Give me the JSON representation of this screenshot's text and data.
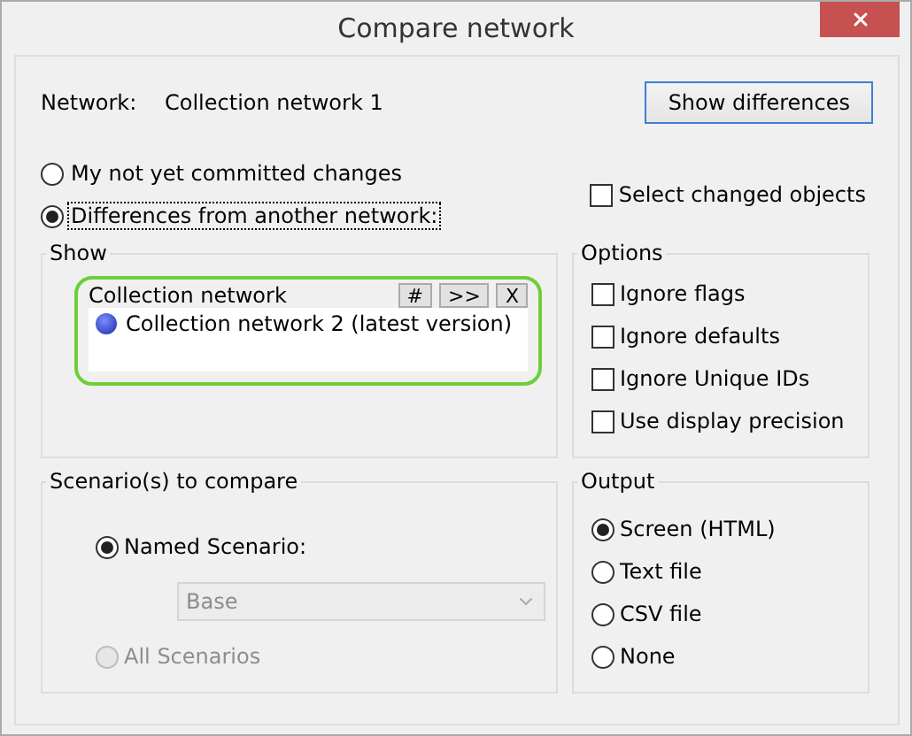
{
  "window": {
    "title": "Compare network"
  },
  "network": {
    "label": "Network:",
    "value": "Collection network 1"
  },
  "show_button": {
    "label": "Show differences"
  },
  "source": [
    {
      "label": "My not yet committed changes",
      "selected": false,
      "focused": false
    },
    {
      "label": "Differences from another network:",
      "selected": true,
      "focused": true
    }
  ],
  "select_changed": {
    "label": "Select changed objects",
    "checked": false
  },
  "show": {
    "title": "Show",
    "list": {
      "title": "Collection network",
      "buttons": [
        "#",
        ">>",
        "X"
      ],
      "items": [
        {
          "label": "Collection network 2 (latest version)"
        }
      ]
    }
  },
  "options": {
    "title": "Options",
    "items": [
      {
        "label": "Ignore flags",
        "checked": false
      },
      {
        "label": "Ignore defaults",
        "checked": false
      },
      {
        "label": "Ignore Unique IDs",
        "checked": false
      },
      {
        "label": "Use display precision",
        "checked": false
      }
    ]
  },
  "scenarios": {
    "title": "Scenario(s) to compare",
    "named": {
      "label": "Named Scenario:",
      "selected": true,
      "disabled": false
    },
    "dropdown": {
      "value": "Base",
      "disabled": true
    },
    "all": {
      "label": "All Scenarios",
      "selected": false,
      "disabled": true
    }
  },
  "output": {
    "title": "Output",
    "items": [
      {
        "label": "Screen (HTML)",
        "selected": true
      },
      {
        "label": "Text file",
        "selected": false
      },
      {
        "label": "CSV file",
        "selected": false
      },
      {
        "label": "None",
        "selected": false
      }
    ]
  }
}
